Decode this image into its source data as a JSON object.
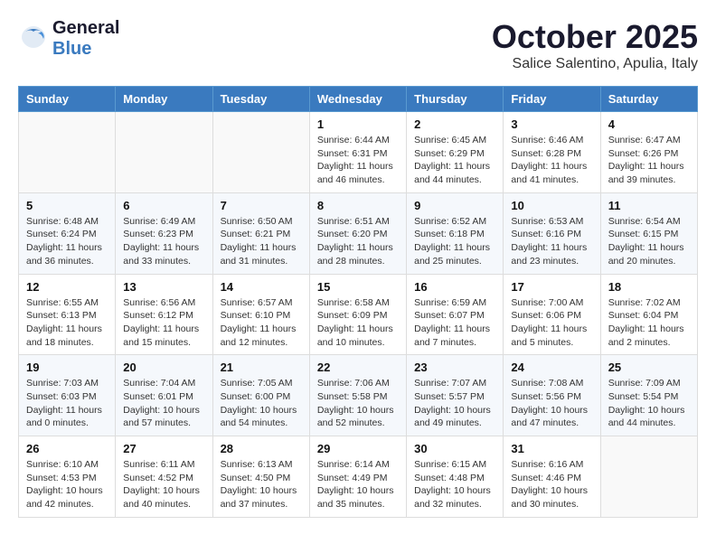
{
  "header": {
    "logo_general": "General",
    "logo_blue": "Blue",
    "month_title": "October 2025",
    "subtitle": "Salice Salentino, Apulia, Italy"
  },
  "weekdays": [
    "Sunday",
    "Monday",
    "Tuesday",
    "Wednesday",
    "Thursday",
    "Friday",
    "Saturday"
  ],
  "weeks": [
    [
      {
        "day": "",
        "info": ""
      },
      {
        "day": "",
        "info": ""
      },
      {
        "day": "",
        "info": ""
      },
      {
        "day": "1",
        "info": "Sunrise: 6:44 AM\nSunset: 6:31 PM\nDaylight: 11 hours\nand 46 minutes."
      },
      {
        "day": "2",
        "info": "Sunrise: 6:45 AM\nSunset: 6:29 PM\nDaylight: 11 hours\nand 44 minutes."
      },
      {
        "day": "3",
        "info": "Sunrise: 6:46 AM\nSunset: 6:28 PM\nDaylight: 11 hours\nand 41 minutes."
      },
      {
        "day": "4",
        "info": "Sunrise: 6:47 AM\nSunset: 6:26 PM\nDaylight: 11 hours\nand 39 minutes."
      }
    ],
    [
      {
        "day": "5",
        "info": "Sunrise: 6:48 AM\nSunset: 6:24 PM\nDaylight: 11 hours\nand 36 minutes."
      },
      {
        "day": "6",
        "info": "Sunrise: 6:49 AM\nSunset: 6:23 PM\nDaylight: 11 hours\nand 33 minutes."
      },
      {
        "day": "7",
        "info": "Sunrise: 6:50 AM\nSunset: 6:21 PM\nDaylight: 11 hours\nand 31 minutes."
      },
      {
        "day": "8",
        "info": "Sunrise: 6:51 AM\nSunset: 6:20 PM\nDaylight: 11 hours\nand 28 minutes."
      },
      {
        "day": "9",
        "info": "Sunrise: 6:52 AM\nSunset: 6:18 PM\nDaylight: 11 hours\nand 25 minutes."
      },
      {
        "day": "10",
        "info": "Sunrise: 6:53 AM\nSunset: 6:16 PM\nDaylight: 11 hours\nand 23 minutes."
      },
      {
        "day": "11",
        "info": "Sunrise: 6:54 AM\nSunset: 6:15 PM\nDaylight: 11 hours\nand 20 minutes."
      }
    ],
    [
      {
        "day": "12",
        "info": "Sunrise: 6:55 AM\nSunset: 6:13 PM\nDaylight: 11 hours\nand 18 minutes."
      },
      {
        "day": "13",
        "info": "Sunrise: 6:56 AM\nSunset: 6:12 PM\nDaylight: 11 hours\nand 15 minutes."
      },
      {
        "day": "14",
        "info": "Sunrise: 6:57 AM\nSunset: 6:10 PM\nDaylight: 11 hours\nand 12 minutes."
      },
      {
        "day": "15",
        "info": "Sunrise: 6:58 AM\nSunset: 6:09 PM\nDaylight: 11 hours\nand 10 minutes."
      },
      {
        "day": "16",
        "info": "Sunrise: 6:59 AM\nSunset: 6:07 PM\nDaylight: 11 hours\nand 7 minutes."
      },
      {
        "day": "17",
        "info": "Sunrise: 7:00 AM\nSunset: 6:06 PM\nDaylight: 11 hours\nand 5 minutes."
      },
      {
        "day": "18",
        "info": "Sunrise: 7:02 AM\nSunset: 6:04 PM\nDaylight: 11 hours\nand 2 minutes."
      }
    ],
    [
      {
        "day": "19",
        "info": "Sunrise: 7:03 AM\nSunset: 6:03 PM\nDaylight: 11 hours\nand 0 minutes."
      },
      {
        "day": "20",
        "info": "Sunrise: 7:04 AM\nSunset: 6:01 PM\nDaylight: 10 hours\nand 57 minutes."
      },
      {
        "day": "21",
        "info": "Sunrise: 7:05 AM\nSunset: 6:00 PM\nDaylight: 10 hours\nand 54 minutes."
      },
      {
        "day": "22",
        "info": "Sunrise: 7:06 AM\nSunset: 5:58 PM\nDaylight: 10 hours\nand 52 minutes."
      },
      {
        "day": "23",
        "info": "Sunrise: 7:07 AM\nSunset: 5:57 PM\nDaylight: 10 hours\nand 49 minutes."
      },
      {
        "day": "24",
        "info": "Sunrise: 7:08 AM\nSunset: 5:56 PM\nDaylight: 10 hours\nand 47 minutes."
      },
      {
        "day": "25",
        "info": "Sunrise: 7:09 AM\nSunset: 5:54 PM\nDaylight: 10 hours\nand 44 minutes."
      }
    ],
    [
      {
        "day": "26",
        "info": "Sunrise: 6:10 AM\nSunset: 4:53 PM\nDaylight: 10 hours\nand 42 minutes."
      },
      {
        "day": "27",
        "info": "Sunrise: 6:11 AM\nSunset: 4:52 PM\nDaylight: 10 hours\nand 40 minutes."
      },
      {
        "day": "28",
        "info": "Sunrise: 6:13 AM\nSunset: 4:50 PM\nDaylight: 10 hours\nand 37 minutes."
      },
      {
        "day": "29",
        "info": "Sunrise: 6:14 AM\nSunset: 4:49 PM\nDaylight: 10 hours\nand 35 minutes."
      },
      {
        "day": "30",
        "info": "Sunrise: 6:15 AM\nSunset: 4:48 PM\nDaylight: 10 hours\nand 32 minutes."
      },
      {
        "day": "31",
        "info": "Sunrise: 6:16 AM\nSunset: 4:46 PM\nDaylight: 10 hours\nand 30 minutes."
      },
      {
        "day": "",
        "info": ""
      }
    ]
  ]
}
